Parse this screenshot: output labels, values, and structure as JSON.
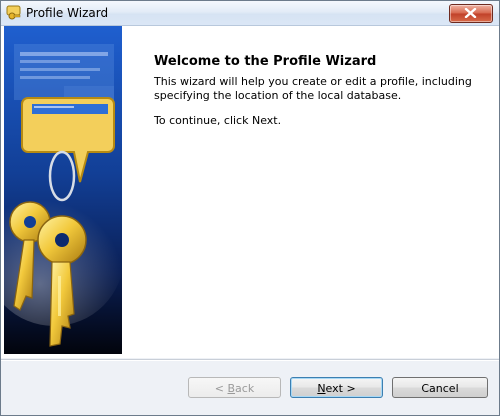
{
  "window": {
    "title": "Profile Wizard",
    "icons": {
      "app": "wizard-keys-icon",
      "close": "close-icon"
    }
  },
  "content": {
    "heading": "Welcome to the Profile Wizard",
    "description": "This wizard will help you create or edit a profile, including specifying the location of the local database.",
    "instruction": "To continue, click Next."
  },
  "buttons": {
    "back": {
      "mnemonic": "B",
      "rest": "ack",
      "prefix": "< ",
      "enabled": false
    },
    "next": {
      "mnemonic": "N",
      "rest": "ext >",
      "enabled": true
    },
    "cancel": "Cancel"
  },
  "colors": {
    "sidebar_top": "#1f5fcf",
    "sidebar_bottom": "#02040c",
    "key_gold": "#f2c93c",
    "close_red": "#c0412a"
  }
}
